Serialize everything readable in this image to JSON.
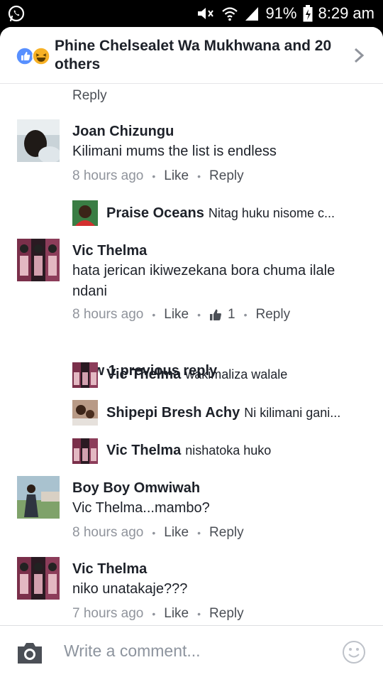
{
  "status_bar": {
    "battery": "91%",
    "time": "8:29 am"
  },
  "header": {
    "title": "Phine Chelsealet Wa Mukhwana and 20 others"
  },
  "top_partial": {
    "reply_label": "Reply"
  },
  "comments": [
    {
      "name": "Joan Chizungu",
      "text": "Kilimani mums the list is endless",
      "time": "8 hours ago",
      "like_label": "Like",
      "reply_label": "Reply"
    },
    {
      "name": "Vic Thelma",
      "text": "hata jerican ikiwezekana bora chuma ilale ndani",
      "time": "8 hours ago",
      "like_label": "Like",
      "like_count": "1",
      "reply_label": "Reply"
    },
    {
      "name": "Boy Boy Omwiwah",
      "text": "Vic Thelma...mambo?",
      "time": "8 hours ago",
      "like_label": "Like",
      "reply_label": "Reply"
    },
    {
      "name": "Vic Thelma",
      "text": "niko unatakaje???",
      "time": "7 hours ago",
      "like_label": "Like",
      "reply_label": "Reply"
    }
  ],
  "replies": [
    {
      "name": "Praise Oceans",
      "text": "Nitag huku nisome c..."
    },
    {
      "name": "Vic Thelma",
      "text": "wakimaliza walale"
    },
    {
      "name": "Shipepi Bresh Achy",
      "text": "Ni kilimani gani..."
    },
    {
      "name": "Vic Thelma",
      "text": "nishatoka huko"
    }
  ],
  "view_previous": "View 1 previous reply",
  "composer": {
    "placeholder": "Write a comment..."
  },
  "icons": {
    "whatsapp": "whatsapp-icon",
    "mute": "mute-icon",
    "wifi": "wifi-icon",
    "signal": "signal-icon",
    "battery": "battery-icon",
    "like_reaction": "like-reaction-icon",
    "haha_reaction": "haha-reaction-icon",
    "chevron": "chevron-right-icon",
    "camera": "camera-icon",
    "smiley": "smiley-icon",
    "thumbs_up": "thumbs-up-icon"
  },
  "colors": {
    "facebook_blue": "#5890ff",
    "text_dark": "#1d2129",
    "text_muted": "#90949c"
  }
}
